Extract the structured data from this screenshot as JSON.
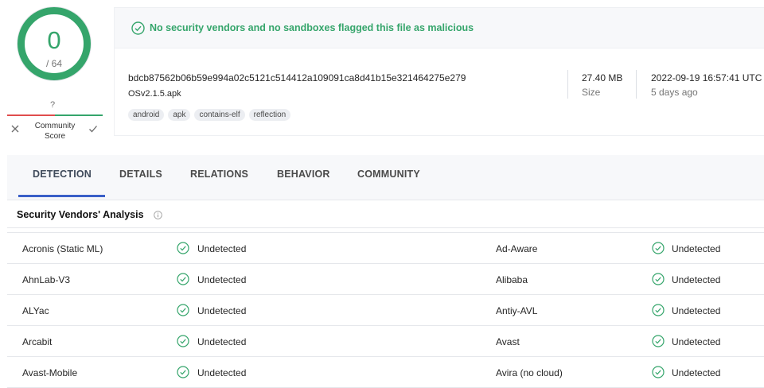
{
  "score": {
    "detections": "0",
    "total": "/ 64"
  },
  "community": {
    "question": "?",
    "label": "Community Score"
  },
  "banner": {
    "message": "No security vendors and no sandboxes flagged this file as malicious"
  },
  "file": {
    "hash": "bdcb87562b06b59e994a02c5121c514412a109091ca8d41b15e321464275e279",
    "name": "OSv2.1.5.apk",
    "tags": [
      "android",
      "apk",
      "contains-elf",
      "reflection"
    ],
    "size_value": "27.40 MB",
    "size_label": "Size",
    "date_value": "2022-09-19 16:57:41 UTC",
    "date_ago": "5 days ago"
  },
  "tabs": [
    "DETECTION",
    "DETAILS",
    "RELATIONS",
    "BEHAVIOR",
    "COMMUNITY"
  ],
  "section": {
    "title": "Security Vendors' Analysis"
  },
  "vendors": [
    {
      "left": "Acronis (Static ML)",
      "left_result": "Undetected",
      "right": "Ad-Aware",
      "right_result": "Undetected"
    },
    {
      "left": "AhnLab-V3",
      "left_result": "Undetected",
      "right": "Alibaba",
      "right_result": "Undetected"
    },
    {
      "left": "ALYac",
      "left_result": "Undetected",
      "right": "Antiy-AVL",
      "right_result": "Undetected"
    },
    {
      "left": "Arcabit",
      "left_result": "Undetected",
      "right": "Avast",
      "right_result": "Undetected"
    },
    {
      "left": "Avast-Mobile",
      "left_result": "Undetected",
      "right": "Avira (no cloud)",
      "right_result": "Undetected"
    }
  ],
  "colors": {
    "accent_green": "#35a56b",
    "danger_red": "#e04d4d",
    "tab_active": "#3a5fc8"
  },
  "icons": {
    "banner": "check-circle-icon",
    "result": "check-circle-icon",
    "info": "info-icon",
    "vote_down": "close-icon",
    "vote_up": "check-icon"
  }
}
